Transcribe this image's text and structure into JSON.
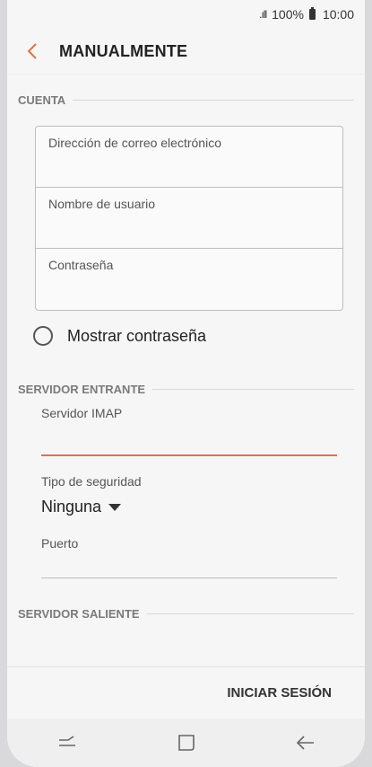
{
  "status": {
    "signal": ".ıll",
    "battery": "100%",
    "time": "10:00"
  },
  "header": {
    "title": "MANUALMENTE"
  },
  "account": {
    "section_title": "CUENTA",
    "email_label": "Dirección de correo electrónico",
    "username_label": "Nombre de usuario",
    "password_label": "Contraseña",
    "show_password_label": "Mostrar contraseña"
  },
  "incoming": {
    "section_title": "SERVIDOR ENTRANTE",
    "imap_label": "Servidor IMAP",
    "security_label": "Tipo de seguridad",
    "security_value": "Ninguna",
    "port_label": "Puerto"
  },
  "outgoing": {
    "section_title": "SERVIDOR SALIENTE"
  },
  "actions": {
    "login_label": "INICIAR SESIÓN"
  },
  "colors": {
    "accent": "#e0724a",
    "background": "#f6f6f6"
  }
}
